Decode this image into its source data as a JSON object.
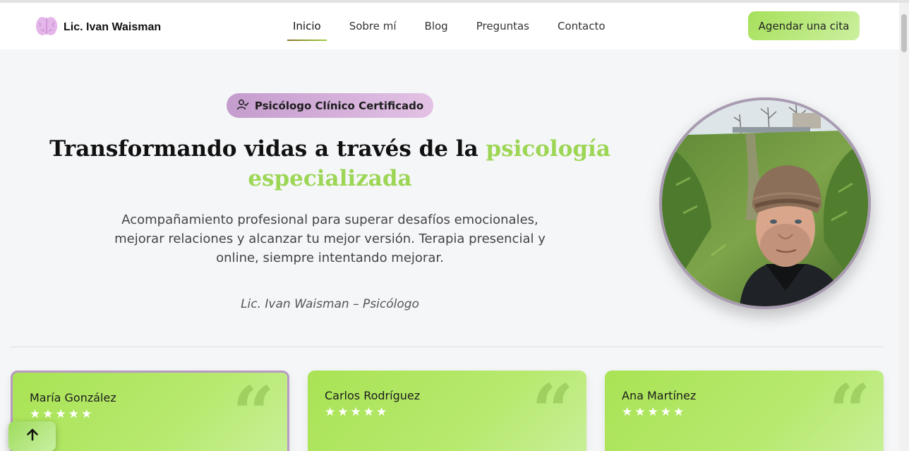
{
  "header": {
    "brand": "Lic. Ivan Waisman",
    "logo_icon": "brain-icon",
    "nav": [
      {
        "label": "Inicio",
        "active": true
      },
      {
        "label": "Sobre mí",
        "active": false
      },
      {
        "label": "Blog",
        "active": false
      },
      {
        "label": "Preguntas",
        "active": false
      },
      {
        "label": "Contacto",
        "active": false
      }
    ],
    "cta_label": "Agendar una cita"
  },
  "hero": {
    "badge_icon": "user-check-icon",
    "badge_label": "Psicólogo Clínico Certificado",
    "title_main": "Transformando vidas a través de la ",
    "title_highlight": "psicología especializada",
    "description": "Acompañamiento profesional para superar desafíos emocionales, mejorar relaciones y alcanzar tu mejor versión. Terapia presencial y online, siempre intentando mejorar.",
    "signature": "Lic. Ivan Waisman – Psicólogo"
  },
  "testimonials": [
    {
      "name": "María González",
      "rating": 5
    },
    {
      "name": "Carlos Rodríguez",
      "rating": 5
    },
    {
      "name": "Ana Martínez",
      "rating": 5
    }
  ],
  "stars_text": "★★★★★",
  "quote_glyph": "“",
  "back_to_top_icon": "arrow-up-icon",
  "colors": {
    "accent_green": "#9cd654",
    "badge_purple": "#c49ccd",
    "cta_green": "#a6e05a"
  }
}
